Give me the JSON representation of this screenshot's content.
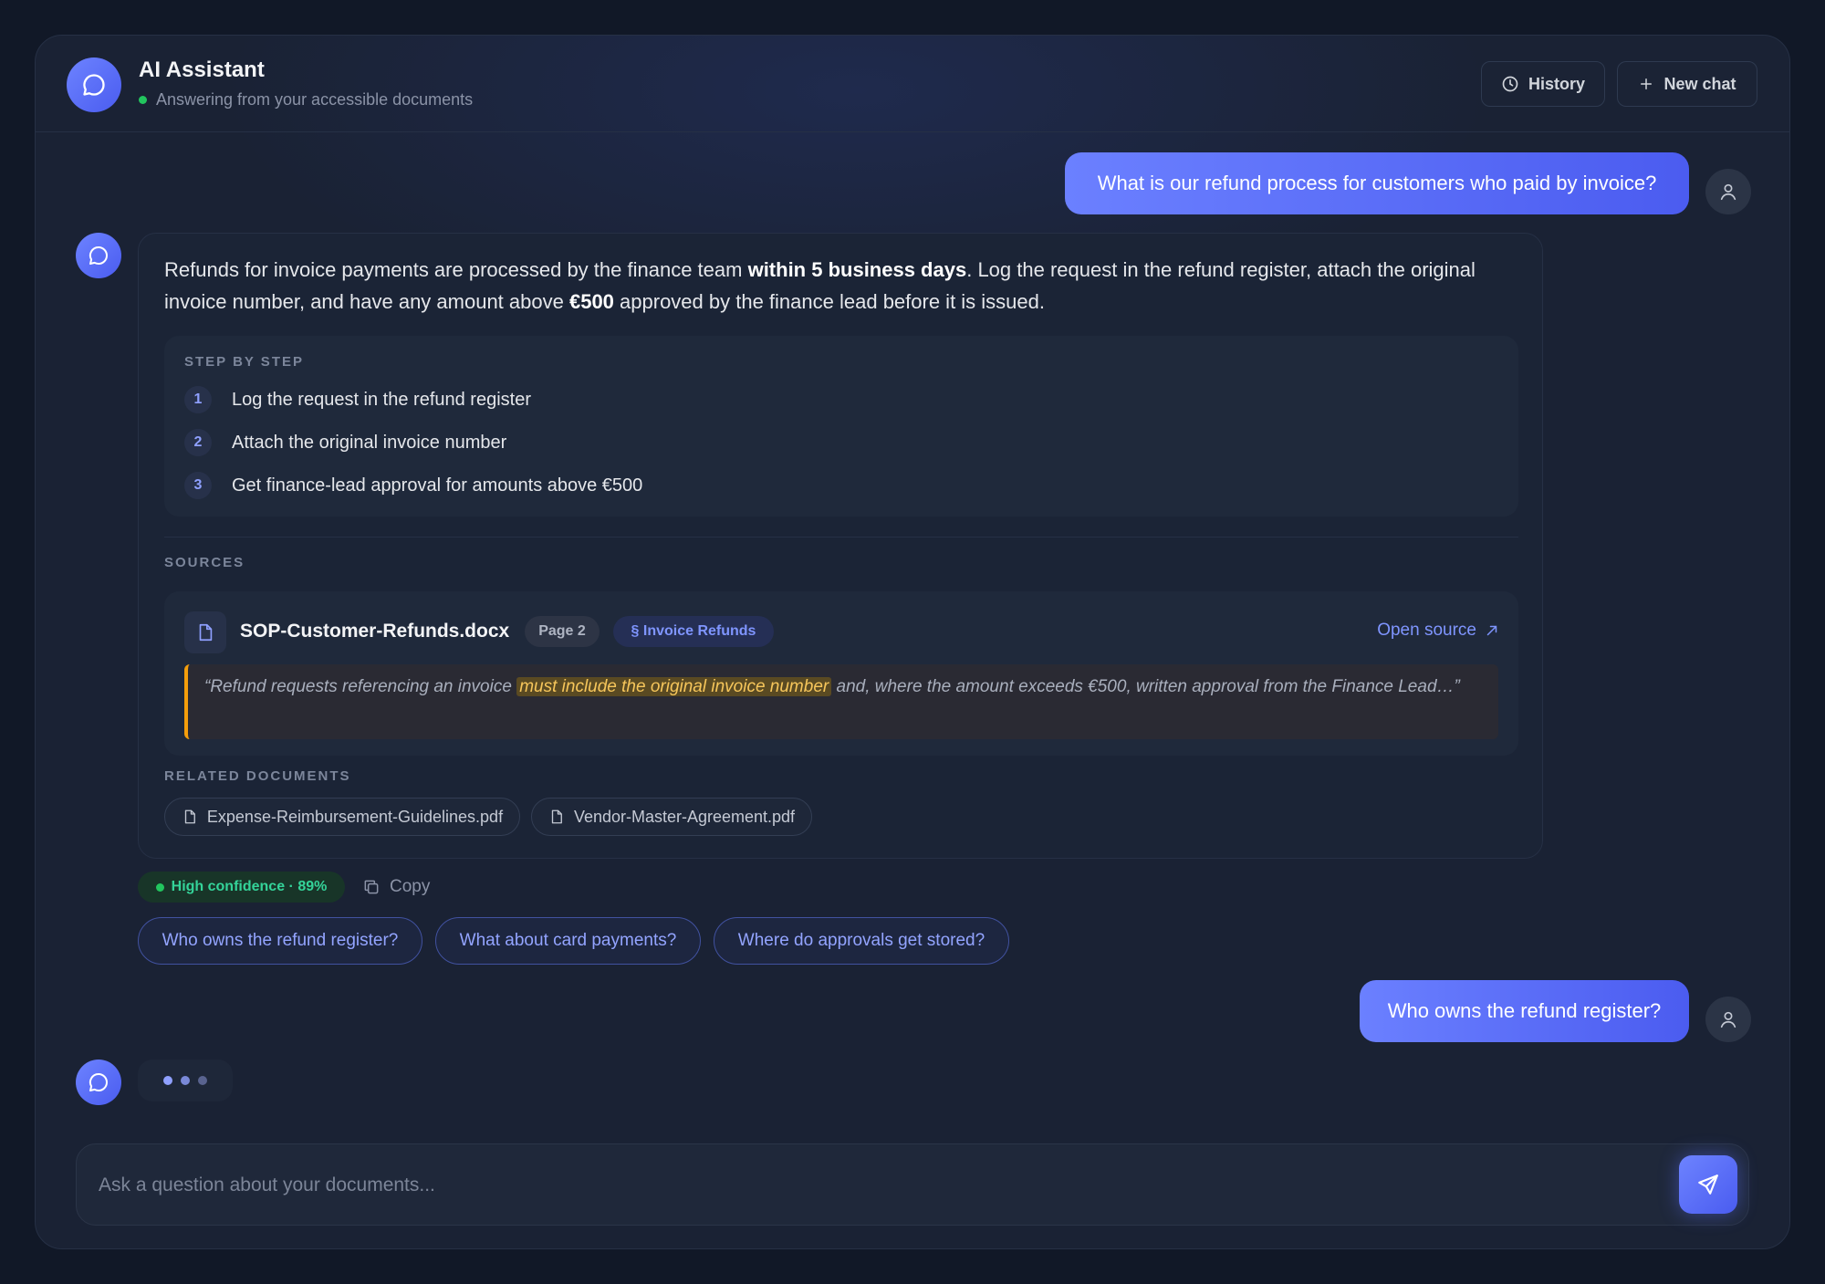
{
  "header": {
    "title": "AI Assistant",
    "status": "Answering from your accessible documents",
    "history_label": "History",
    "new_chat_label": "New chat"
  },
  "conversation": {
    "user_message_1": "What is our refund process for customers who paid by invoice?",
    "answer": {
      "text_part1": "Refunds for invoice payments are processed by the finance team ",
      "text_bold1": "within 5 business days",
      "text_part2": ". Log the request in the refund register, attach the original invoice number, and have any amount above ",
      "text_bold2": "€500",
      "text_part3": " approved by the finance lead before it is issued.",
      "steps_label": "STEP BY STEP",
      "steps": [
        {
          "num": "1",
          "text": "Log the request in the refund register"
        },
        {
          "num": "2",
          "text": "Attach the original invoice number"
        },
        {
          "num": "3",
          "text": "Get finance-lead approval for amounts above €500"
        }
      ],
      "sources_label": "SOURCES",
      "source": {
        "name": "SOP-Customer-Refunds.docx",
        "page": "Page 2",
        "section": "§ Invoice Refunds",
        "open_label": "Open source",
        "quote_part1": "“Refund requests referencing an invoice ",
        "quote_highlight": "must include the original invoice number",
        "quote_part2": " and, where the amount exceeds €500, written approval from the Finance Lead…”"
      },
      "related_label": "RELATED DOCUMENTS",
      "related": [
        "Expense-Reimbursement-Guidelines.pdf",
        "Vendor-Master-Agreement.pdf"
      ]
    },
    "confidence": "High confidence · 89%",
    "copy_label": "Copy",
    "suggestions": [
      "Who owns the refund register?",
      "What about card payments?",
      "Where do approvals get stored?"
    ],
    "user_message_2": "Who owns the refund register?"
  },
  "composer": {
    "placeholder": "Ask a question about your documents..."
  },
  "colors": {
    "accent": "#5b6ef5",
    "background": "#1a2234",
    "success": "#34d399",
    "highlight": "#f6c65b"
  },
  "icons": {
    "logo": "chat-bubble-icon",
    "history": "clock-icon",
    "new_chat": "plus-icon",
    "user": "user-icon",
    "doc": "file-icon",
    "copy": "copy-icon",
    "send": "send-icon",
    "open": "external-arrow-icon"
  }
}
